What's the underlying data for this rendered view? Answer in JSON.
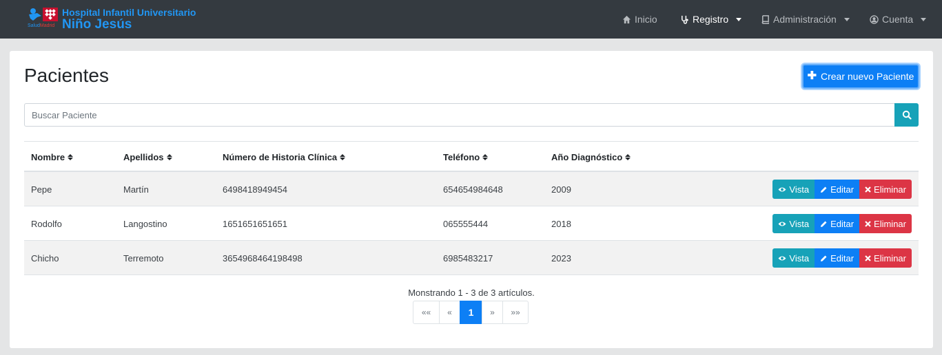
{
  "brand": {
    "line1": "Hospital Infantil Universitario",
    "line2": "Niño Jesús",
    "logo_small_a": "Salud",
    "logo_small_b": "Madrid"
  },
  "nav": {
    "inicio": "Inicio",
    "registro": "Registro",
    "administracion": "Administración",
    "cuenta": "Cuenta"
  },
  "page": {
    "title": "Pacientes",
    "create_label": "Crear nuevo Paciente",
    "search_placeholder": "Buscar Paciente"
  },
  "table": {
    "headers": [
      "Nombre",
      "Apellidos",
      "Número de Historia Clínica",
      "Teléfono",
      "Año Diagnóstico"
    ],
    "rows": [
      [
        "Pepe",
        "Martín",
        "6498418949454",
        "654654984648",
        "2009"
      ],
      [
        "Rodolfo",
        "Langostino",
        "1651651651651",
        "065555444",
        "2018"
      ],
      [
        "Chicho",
        "Terremoto",
        "3654968464198498",
        "6985483217",
        "2023"
      ]
    ],
    "actions": {
      "view": "Vista",
      "edit": "Editar",
      "delete": "Eliminar"
    }
  },
  "footer": {
    "info": "Monstrando 1 - 3 de 3 artículos.",
    "pagination": [
      "««",
      "«",
      "1",
      "»",
      "»»"
    ]
  },
  "colors": {
    "navbar": "#343a40",
    "primary": "#0d7ff5",
    "info": "#17a2b8",
    "danger": "#dc3545",
    "brand": "#2196f3"
  }
}
